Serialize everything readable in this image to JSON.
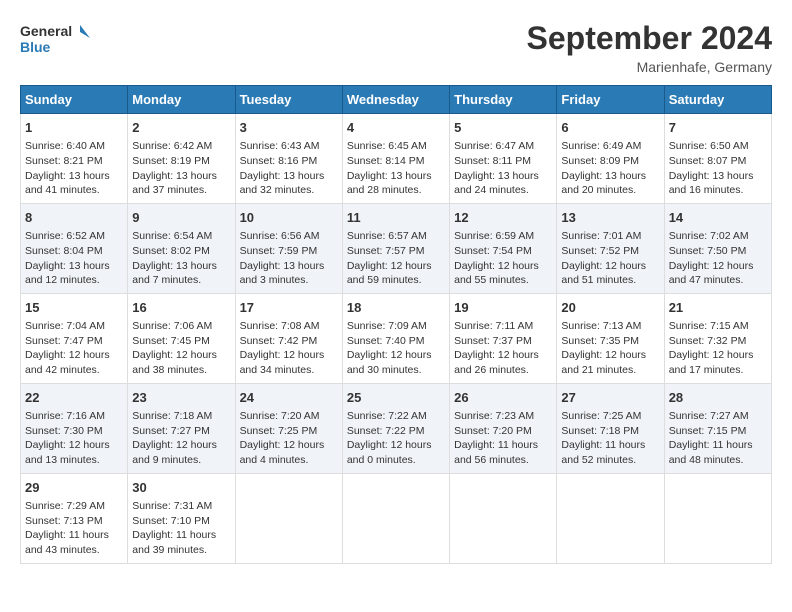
{
  "header": {
    "logo_line1": "General",
    "logo_line2": "Blue",
    "month": "September 2024",
    "location": "Marienhafe, Germany"
  },
  "days_of_week": [
    "Sunday",
    "Monday",
    "Tuesday",
    "Wednesday",
    "Thursday",
    "Friday",
    "Saturday"
  ],
  "weeks": [
    [
      {
        "day": "1",
        "lines": [
          "Sunrise: 6:40 AM",
          "Sunset: 8:21 PM",
          "Daylight: 13 hours",
          "and 41 minutes."
        ]
      },
      {
        "day": "2",
        "lines": [
          "Sunrise: 6:42 AM",
          "Sunset: 8:19 PM",
          "Daylight: 13 hours",
          "and 37 minutes."
        ]
      },
      {
        "day": "3",
        "lines": [
          "Sunrise: 6:43 AM",
          "Sunset: 8:16 PM",
          "Daylight: 13 hours",
          "and 32 minutes."
        ]
      },
      {
        "day": "4",
        "lines": [
          "Sunrise: 6:45 AM",
          "Sunset: 8:14 PM",
          "Daylight: 13 hours",
          "and 28 minutes."
        ]
      },
      {
        "day": "5",
        "lines": [
          "Sunrise: 6:47 AM",
          "Sunset: 8:11 PM",
          "Daylight: 13 hours",
          "and 24 minutes."
        ]
      },
      {
        "day": "6",
        "lines": [
          "Sunrise: 6:49 AM",
          "Sunset: 8:09 PM",
          "Daylight: 13 hours",
          "and 20 minutes."
        ]
      },
      {
        "day": "7",
        "lines": [
          "Sunrise: 6:50 AM",
          "Sunset: 8:07 PM",
          "Daylight: 13 hours",
          "and 16 minutes."
        ]
      }
    ],
    [
      {
        "day": "8",
        "lines": [
          "Sunrise: 6:52 AM",
          "Sunset: 8:04 PM",
          "Daylight: 13 hours",
          "and 12 minutes."
        ]
      },
      {
        "day": "9",
        "lines": [
          "Sunrise: 6:54 AM",
          "Sunset: 8:02 PM",
          "Daylight: 13 hours",
          "and 7 minutes."
        ]
      },
      {
        "day": "10",
        "lines": [
          "Sunrise: 6:56 AM",
          "Sunset: 7:59 PM",
          "Daylight: 13 hours",
          "and 3 minutes."
        ]
      },
      {
        "day": "11",
        "lines": [
          "Sunrise: 6:57 AM",
          "Sunset: 7:57 PM",
          "Daylight: 12 hours",
          "and 59 minutes."
        ]
      },
      {
        "day": "12",
        "lines": [
          "Sunrise: 6:59 AM",
          "Sunset: 7:54 PM",
          "Daylight: 12 hours",
          "and 55 minutes."
        ]
      },
      {
        "day": "13",
        "lines": [
          "Sunrise: 7:01 AM",
          "Sunset: 7:52 PM",
          "Daylight: 12 hours",
          "and 51 minutes."
        ]
      },
      {
        "day": "14",
        "lines": [
          "Sunrise: 7:02 AM",
          "Sunset: 7:50 PM",
          "Daylight: 12 hours",
          "and 47 minutes."
        ]
      }
    ],
    [
      {
        "day": "15",
        "lines": [
          "Sunrise: 7:04 AM",
          "Sunset: 7:47 PM",
          "Daylight: 12 hours",
          "and 42 minutes."
        ]
      },
      {
        "day": "16",
        "lines": [
          "Sunrise: 7:06 AM",
          "Sunset: 7:45 PM",
          "Daylight: 12 hours",
          "and 38 minutes."
        ]
      },
      {
        "day": "17",
        "lines": [
          "Sunrise: 7:08 AM",
          "Sunset: 7:42 PM",
          "Daylight: 12 hours",
          "and 34 minutes."
        ]
      },
      {
        "day": "18",
        "lines": [
          "Sunrise: 7:09 AM",
          "Sunset: 7:40 PM",
          "Daylight: 12 hours",
          "and 30 minutes."
        ]
      },
      {
        "day": "19",
        "lines": [
          "Sunrise: 7:11 AM",
          "Sunset: 7:37 PM",
          "Daylight: 12 hours",
          "and 26 minutes."
        ]
      },
      {
        "day": "20",
        "lines": [
          "Sunrise: 7:13 AM",
          "Sunset: 7:35 PM",
          "Daylight: 12 hours",
          "and 21 minutes."
        ]
      },
      {
        "day": "21",
        "lines": [
          "Sunrise: 7:15 AM",
          "Sunset: 7:32 PM",
          "Daylight: 12 hours",
          "and 17 minutes."
        ]
      }
    ],
    [
      {
        "day": "22",
        "lines": [
          "Sunrise: 7:16 AM",
          "Sunset: 7:30 PM",
          "Daylight: 12 hours",
          "and 13 minutes."
        ]
      },
      {
        "day": "23",
        "lines": [
          "Sunrise: 7:18 AM",
          "Sunset: 7:27 PM",
          "Daylight: 12 hours",
          "and 9 minutes."
        ]
      },
      {
        "day": "24",
        "lines": [
          "Sunrise: 7:20 AM",
          "Sunset: 7:25 PM",
          "Daylight: 12 hours",
          "and 4 minutes."
        ]
      },
      {
        "day": "25",
        "lines": [
          "Sunrise: 7:22 AM",
          "Sunset: 7:22 PM",
          "Daylight: 12 hours",
          "and 0 minutes."
        ]
      },
      {
        "day": "26",
        "lines": [
          "Sunrise: 7:23 AM",
          "Sunset: 7:20 PM",
          "Daylight: 11 hours",
          "and 56 minutes."
        ]
      },
      {
        "day": "27",
        "lines": [
          "Sunrise: 7:25 AM",
          "Sunset: 7:18 PM",
          "Daylight: 11 hours",
          "and 52 minutes."
        ]
      },
      {
        "day": "28",
        "lines": [
          "Sunrise: 7:27 AM",
          "Sunset: 7:15 PM",
          "Daylight: 11 hours",
          "and 48 minutes."
        ]
      }
    ],
    [
      {
        "day": "29",
        "lines": [
          "Sunrise: 7:29 AM",
          "Sunset: 7:13 PM",
          "Daylight: 11 hours",
          "and 43 minutes."
        ]
      },
      {
        "day": "30",
        "lines": [
          "Sunrise: 7:31 AM",
          "Sunset: 7:10 PM",
          "Daylight: 11 hours",
          "and 39 minutes."
        ]
      },
      null,
      null,
      null,
      null,
      null
    ]
  ]
}
